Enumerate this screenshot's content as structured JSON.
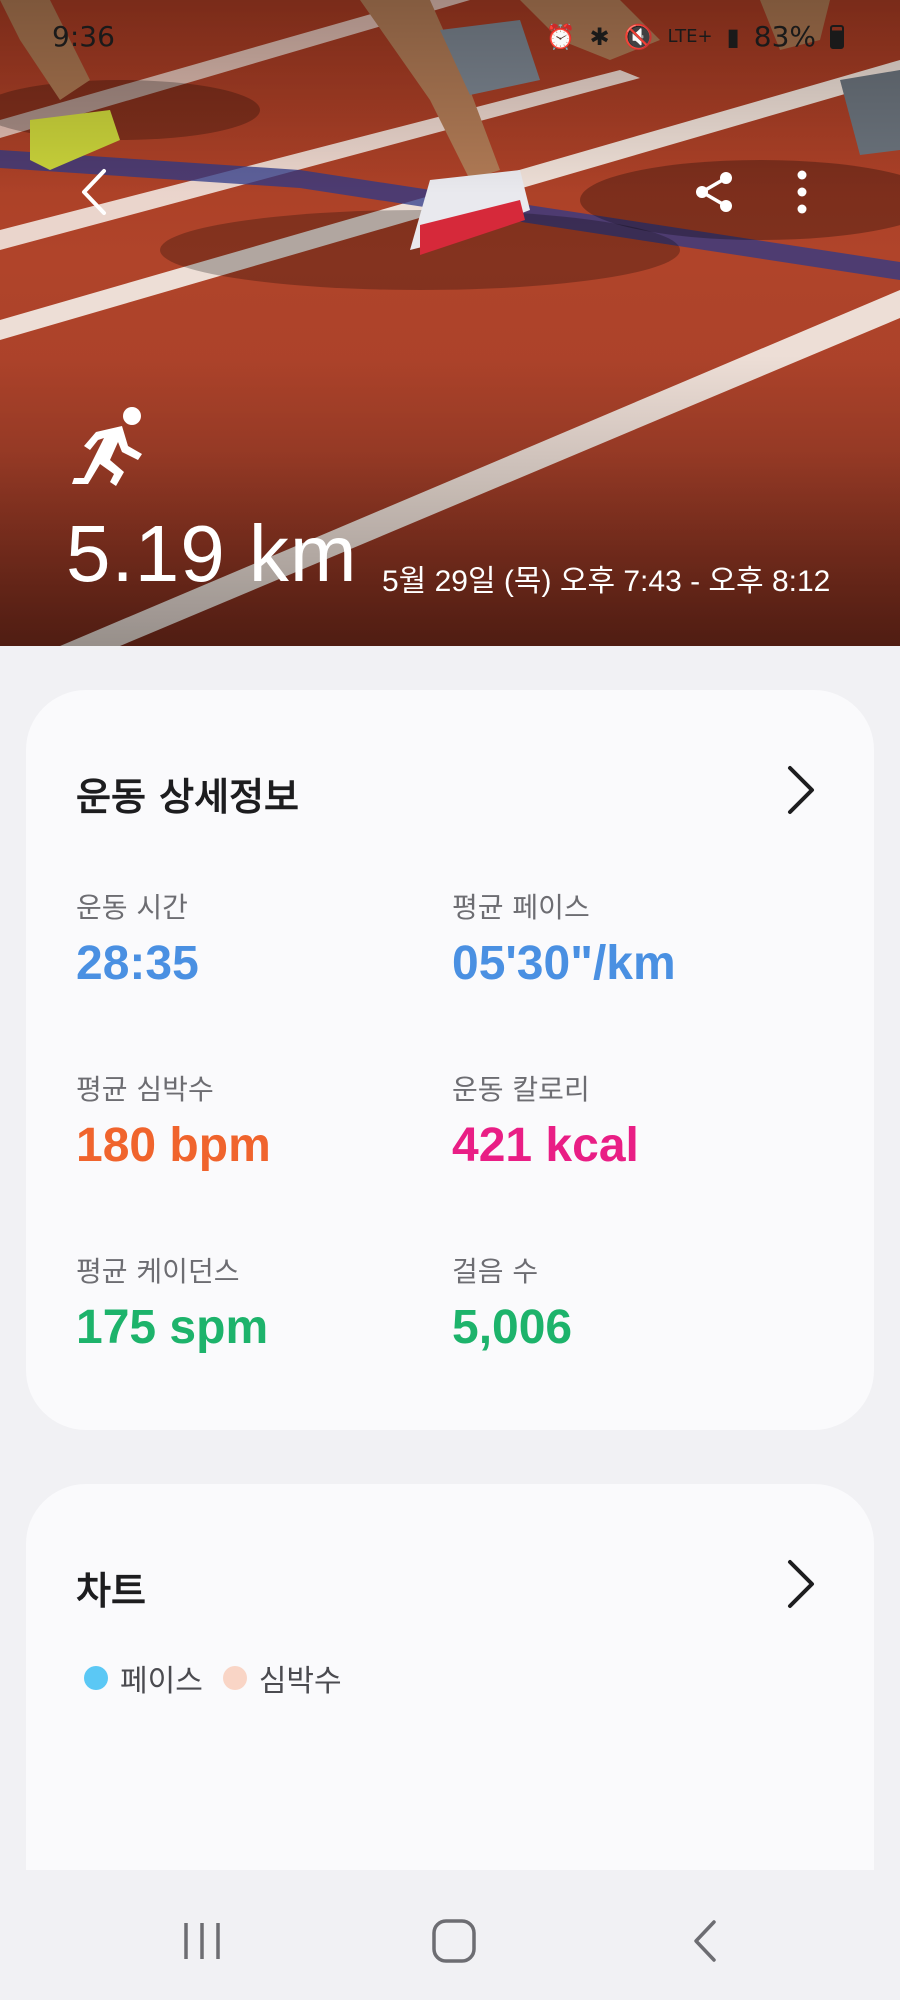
{
  "status_bar": {
    "time": "9:36",
    "network": "LTE+",
    "battery": "83%"
  },
  "hero": {
    "distance": "5.19 km",
    "datetime": "5월 29일 (목) 오후 7:43 - 오후 8:12",
    "activity_icon": "running-person-icon"
  },
  "details": {
    "title": "운동 상세정보",
    "stats": [
      {
        "label": "운동 시간",
        "value": "28:35",
        "color": "#4a90e2"
      },
      {
        "label": "평균 페이스",
        "value": "05'30\"/km",
        "color": "#4a90e2"
      },
      {
        "label": "평균 심박수",
        "value": "180 bpm",
        "color": "#f0642d"
      },
      {
        "label": "운동 칼로리",
        "value": "421 kcal",
        "color": "#e91e85"
      },
      {
        "label": "평균 케이던스",
        "value": "175 spm",
        "color": "#1db36b"
      },
      {
        "label": "걸음 수",
        "value": "5,006",
        "color": "#1db36b"
      }
    ]
  },
  "chart_card": {
    "title": "차트",
    "legend": [
      {
        "label": "페이스",
        "color": "#5bc8f5"
      },
      {
        "label": "심박수",
        "color": "#f9d5c6"
      }
    ]
  },
  "colors": {
    "track": "#a63d25",
    "card_bg": "#fafafc",
    "page_bg": "#f1f1f4"
  }
}
